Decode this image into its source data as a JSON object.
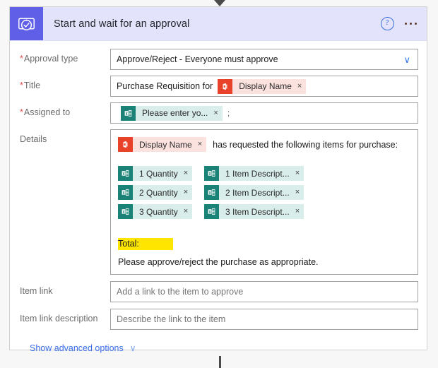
{
  "header": {
    "title": "Start and wait for an approval",
    "app_icon": "approval-clock-check-icon",
    "help_icon": "?",
    "more_icon": "ellipsis-icon",
    "accent_color": "#605fe8",
    "band_color": "#e3e3fb"
  },
  "fields": {
    "approval_type": {
      "label": "Approval type",
      "required": true,
      "value": "Approve/Reject - Everyone must approve",
      "chevron": "∨"
    },
    "title": {
      "label": "Title",
      "required": true,
      "text_prefix": "Purchase Requisition for",
      "token": {
        "label": "Display Name",
        "icon": "office365-outlook-icon",
        "color": "#e8432a",
        "chip_color": "#fbe2df",
        "remove": "×"
      }
    },
    "assigned_to": {
      "label": "Assigned to",
      "required": true,
      "token": {
        "label": "Please enter yo...",
        "icon": "sharepoint-icon",
        "color": "#1a8276",
        "chip_color": "#d9edea",
        "remove": "×"
      },
      "separator": ";"
    },
    "details": {
      "label": "Details",
      "required": false,
      "intro_token": {
        "label": "Display Name",
        "icon": "office365-outlook-icon",
        "color": "#e8432a",
        "chip_color": "#fbe2df",
        "remove": "×"
      },
      "intro_text": "has requested the following items for purchase:",
      "token_rows": [
        {
          "quantity": {
            "label": "1 Quantity",
            "icon": "sharepoint-icon",
            "remove": "×"
          },
          "description": {
            "label": "1 Item Descript...",
            "icon": "sharepoint-icon",
            "remove": "×"
          }
        },
        {
          "quantity": {
            "label": "2 Quantity",
            "icon": "sharepoint-icon",
            "remove": "×"
          },
          "description": {
            "label": "2 Item Descript...",
            "icon": "sharepoint-icon",
            "remove": "×"
          }
        },
        {
          "quantity": {
            "label": "3 Quantity",
            "icon": "sharepoint-icon",
            "remove": "×"
          },
          "description": {
            "label": "3 Item Descript...",
            "icon": "sharepoint-icon",
            "remove": "×"
          }
        }
      ],
      "total_label": "Total:",
      "total_highlight_color": "#ffe500",
      "closing_text": "Please approve/reject the purchase as appropriate."
    },
    "item_link": {
      "label": "Item link",
      "required": false,
      "placeholder": "Add a link to the item to approve",
      "value": ""
    },
    "item_link_description": {
      "label": "Item link description",
      "required": false,
      "placeholder": "Describe the link to the item",
      "value": ""
    }
  },
  "footer": {
    "advanced_label": "Show advanced options",
    "advanced_chevron": "∨",
    "link_color": "#3b6ee8"
  }
}
